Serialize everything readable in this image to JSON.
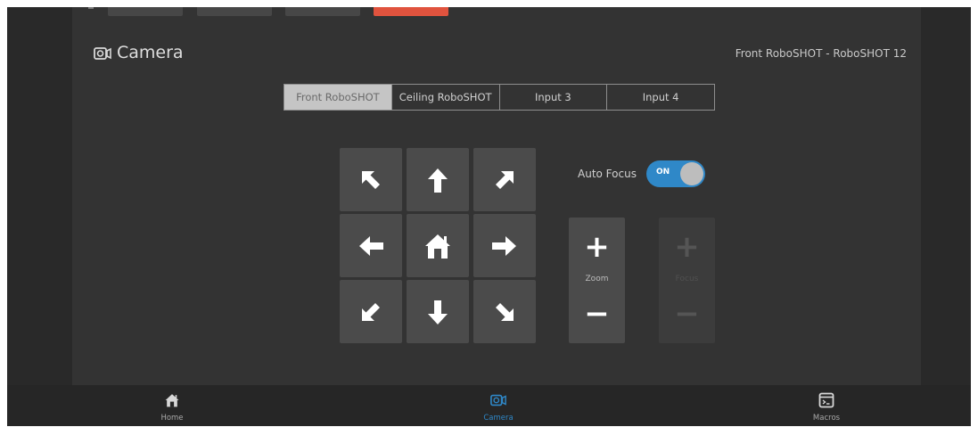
{
  "header": {
    "icon": "camera-icon",
    "title": "Camera",
    "device": "Front RoboSHOT - RoboSHOT 12"
  },
  "inputs": {
    "selected_index": 0,
    "items": [
      "Front RoboSHOT",
      "Ceiling RoboSHOT",
      "Input 3",
      "Input 4"
    ]
  },
  "pad": {
    "buttons": [
      {
        "name": "pan-up-left-button",
        "icon": "arrow-up-left-icon"
      },
      {
        "name": "pan-up-button",
        "icon": "arrow-up-icon"
      },
      {
        "name": "pan-up-right-button",
        "icon": "arrow-up-right-icon"
      },
      {
        "name": "pan-left-button",
        "icon": "arrow-left-icon"
      },
      {
        "name": "home-position-button",
        "icon": "home-icon"
      },
      {
        "name": "pan-right-button",
        "icon": "arrow-right-icon"
      },
      {
        "name": "pan-down-left-button",
        "icon": "arrow-down-left-icon"
      },
      {
        "name": "pan-down-button",
        "icon": "arrow-down-icon"
      },
      {
        "name": "pan-down-right-button",
        "icon": "arrow-down-right-icon"
      }
    ]
  },
  "auto_focus": {
    "label": "Auto Focus",
    "state_text": "ON",
    "on": true
  },
  "zoom": {
    "label": "Zoom",
    "enabled": true
  },
  "focus": {
    "label": "Focus",
    "enabled": false
  },
  "nav": {
    "items": [
      {
        "label": "Home",
        "icon": "home-icon",
        "active": false
      },
      {
        "label": "Camera",
        "icon": "camera-icon",
        "active": true
      },
      {
        "label": "Macros",
        "icon": "macros-icon",
        "active": false
      }
    ]
  },
  "colors": {
    "accent": "#2f88c8",
    "alert_tab": "#e0533e",
    "background": "#333333"
  }
}
